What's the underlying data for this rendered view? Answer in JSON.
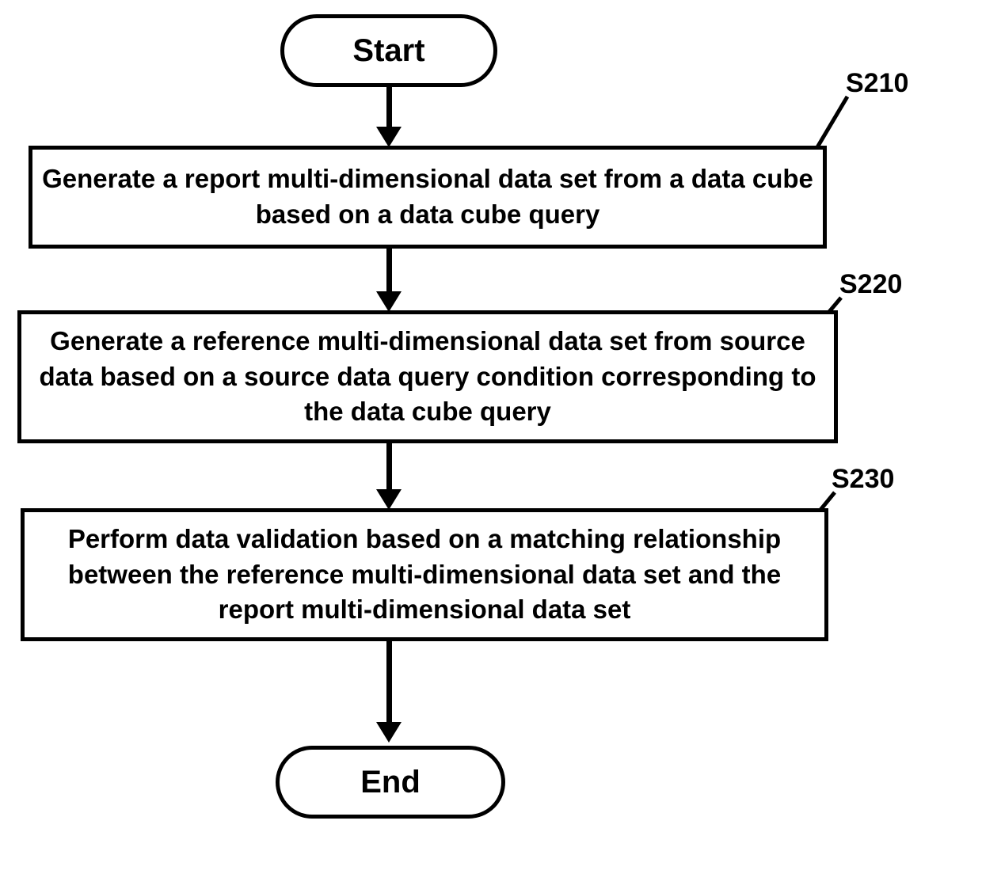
{
  "terminators": {
    "start": "Start",
    "end": "End"
  },
  "steps": {
    "s210": {
      "label": "S210",
      "text": "Generate a report multi-dimensional data set from a data cube based on a data cube query"
    },
    "s220": {
      "label": "S220",
      "text": "Generate a reference multi-dimensional data set from source data based on a source data query condition corresponding to the data cube query"
    },
    "s230": {
      "label": "S230",
      "text": "Perform data validation based on a matching relationship between the reference multi-dimensional data set and the report multi-dimensional data set"
    }
  },
  "chart_data": {
    "type": "flowchart",
    "nodes": [
      {
        "id": "start",
        "kind": "terminator",
        "text": "Start"
      },
      {
        "id": "S210",
        "kind": "process",
        "text": "Generate a report multi-dimensional data set from a data cube based on a data cube query"
      },
      {
        "id": "S220",
        "kind": "process",
        "text": "Generate a reference multi-dimensional data set from source data based on a source data query condition corresponding to the data cube query"
      },
      {
        "id": "S230",
        "kind": "process",
        "text": "Perform data validation based on a matching relationship between the reference multi-dimensional data set and the report multi-dimensional data set"
      },
      {
        "id": "end",
        "kind": "terminator",
        "text": "End"
      }
    ],
    "edges": [
      {
        "from": "start",
        "to": "S210"
      },
      {
        "from": "S210",
        "to": "S220"
      },
      {
        "from": "S220",
        "to": "S230"
      },
      {
        "from": "S230",
        "to": "end"
      }
    ],
    "step_labels": [
      "S210",
      "S220",
      "S230"
    ]
  }
}
